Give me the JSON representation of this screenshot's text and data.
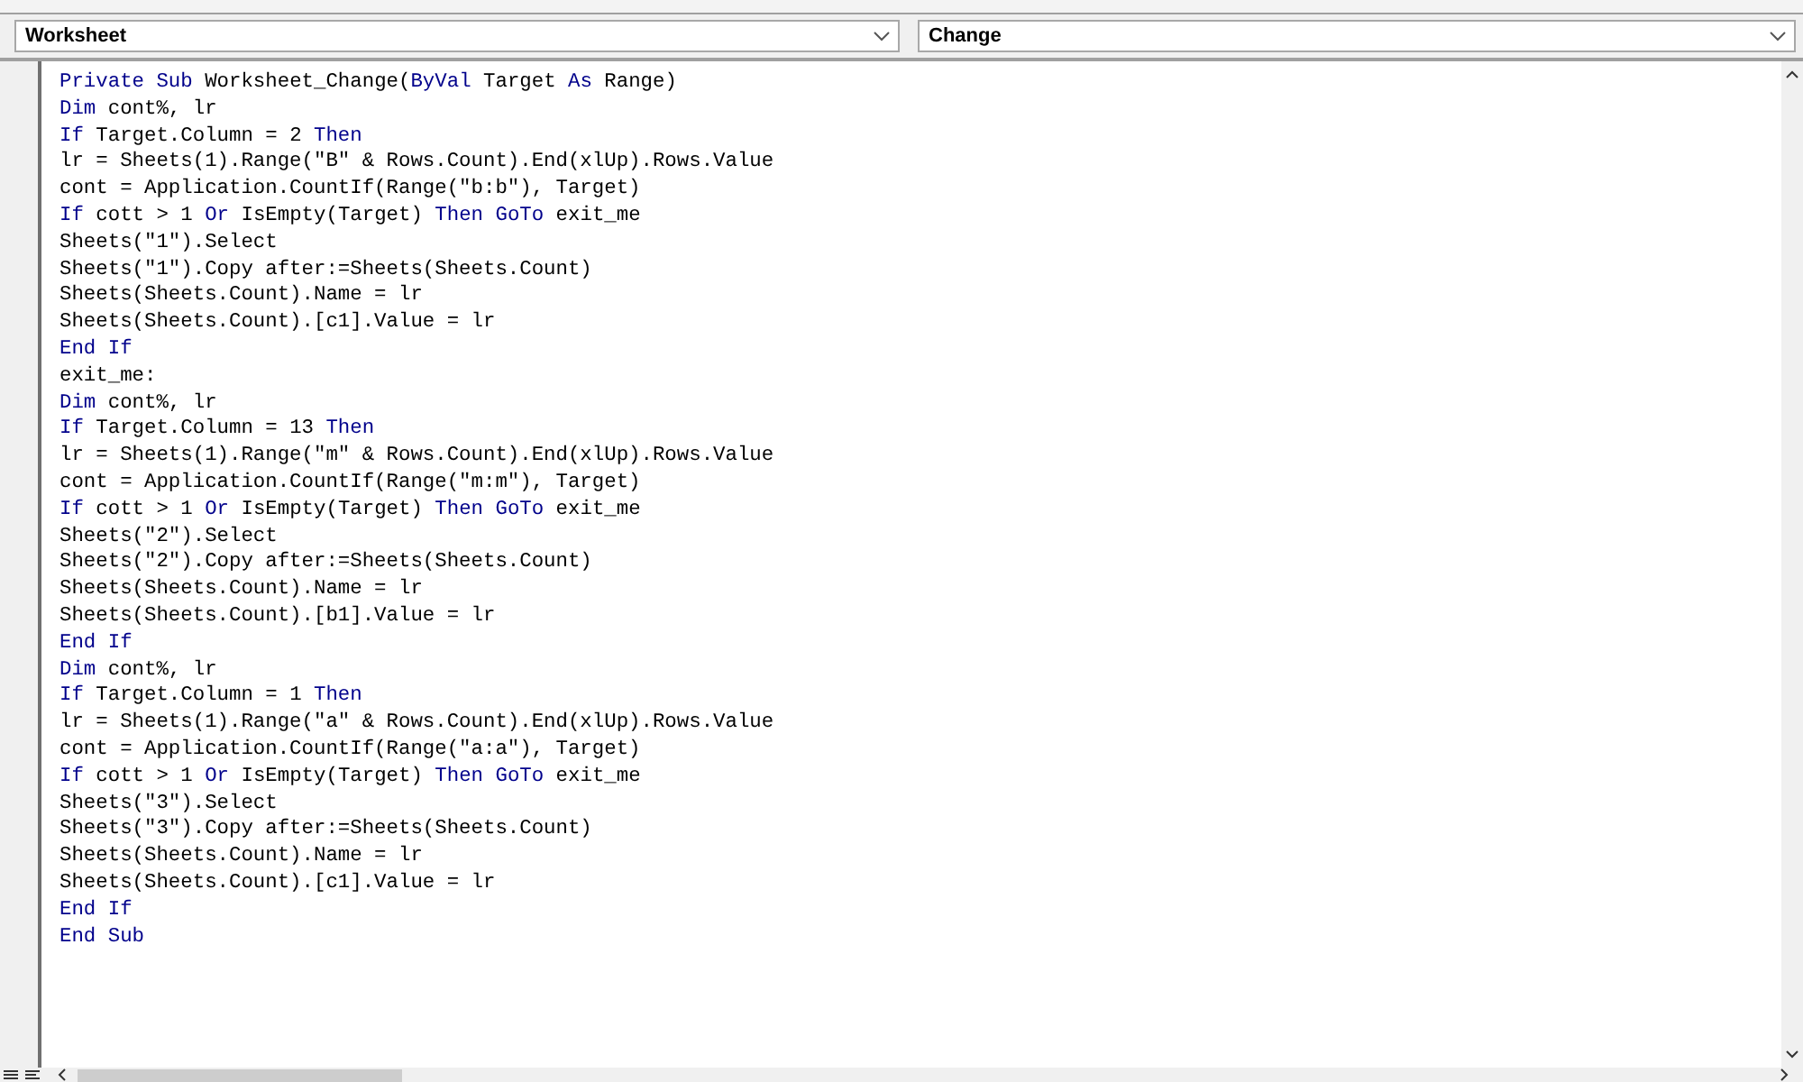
{
  "object_dropdown": {
    "value": "Worksheet"
  },
  "procedure_dropdown": {
    "value": "Change"
  },
  "code_lines": [
    {
      "tokens": [
        {
          "kind": "keyword",
          "text": "Private Sub"
        },
        {
          "kind": "plain",
          "text": " Worksheet_Change("
        },
        {
          "kind": "keyword",
          "text": "ByVal"
        },
        {
          "kind": "plain",
          "text": " Target "
        },
        {
          "kind": "keyword",
          "text": "As"
        },
        {
          "kind": "plain",
          "text": " Range)"
        }
      ]
    },
    {
      "tokens": [
        {
          "kind": "keyword",
          "text": "Dim"
        },
        {
          "kind": "plain",
          "text": " cont%, lr"
        }
      ]
    },
    {
      "tokens": [
        {
          "kind": "keyword",
          "text": "If"
        },
        {
          "kind": "plain",
          "text": " Target.Column = 2 "
        },
        {
          "kind": "keyword",
          "text": "Then"
        }
      ]
    },
    {
      "tokens": [
        {
          "kind": "plain",
          "text": "lr = Sheets(1).Range(\"B\" & Rows.Count).End(xlUp).Rows.Value"
        }
      ]
    },
    {
      "tokens": [
        {
          "kind": "plain",
          "text": "cont = Application.CountIf(Range(\"b:b\"), Target)"
        }
      ]
    },
    {
      "tokens": [
        {
          "kind": "keyword",
          "text": "If"
        },
        {
          "kind": "plain",
          "text": " cott > 1 "
        },
        {
          "kind": "keyword",
          "text": "Or"
        },
        {
          "kind": "plain",
          "text": " IsEmpty(Target) "
        },
        {
          "kind": "keyword",
          "text": "Then GoTo"
        },
        {
          "kind": "plain",
          "text": " exit_me"
        }
      ]
    },
    {
      "tokens": [
        {
          "kind": "plain",
          "text": "Sheets(\"1\").Select"
        }
      ]
    },
    {
      "tokens": [
        {
          "kind": "plain",
          "text": "Sheets(\"1\").Copy after:=Sheets(Sheets.Count)"
        }
      ]
    },
    {
      "tokens": [
        {
          "kind": "plain",
          "text": "Sheets(Sheets.Count).Name = lr"
        }
      ]
    },
    {
      "tokens": [
        {
          "kind": "plain",
          "text": "Sheets(Sheets.Count).[c1].Value = lr"
        }
      ]
    },
    {
      "tokens": [
        {
          "kind": "keyword",
          "text": "End If"
        }
      ]
    },
    {
      "tokens": [
        {
          "kind": "plain",
          "text": "exit_me:"
        }
      ]
    },
    {
      "tokens": [
        {
          "kind": "keyword",
          "text": "Dim"
        },
        {
          "kind": "plain",
          "text": " cont%, lr"
        }
      ]
    },
    {
      "tokens": [
        {
          "kind": "keyword",
          "text": "If"
        },
        {
          "kind": "plain",
          "text": " Target.Column = 13 "
        },
        {
          "kind": "keyword",
          "text": "Then"
        }
      ]
    },
    {
      "tokens": [
        {
          "kind": "plain",
          "text": "lr = Sheets(1).Range(\"m\" & Rows.Count).End(xlUp).Rows.Value"
        }
      ]
    },
    {
      "tokens": [
        {
          "kind": "plain",
          "text": "cont = Application.CountIf(Range(\"m:m\"), Target)"
        }
      ]
    },
    {
      "tokens": [
        {
          "kind": "keyword",
          "text": "If"
        },
        {
          "kind": "plain",
          "text": " cott > 1 "
        },
        {
          "kind": "keyword",
          "text": "Or"
        },
        {
          "kind": "plain",
          "text": " IsEmpty(Target) "
        },
        {
          "kind": "keyword",
          "text": "Then GoTo"
        },
        {
          "kind": "plain",
          "text": " exit_me"
        }
      ]
    },
    {
      "tokens": [
        {
          "kind": "plain",
          "text": "Sheets(\"2\").Select"
        }
      ]
    },
    {
      "tokens": [
        {
          "kind": "plain",
          "text": "Sheets(\"2\").Copy after:=Sheets(Sheets.Count)"
        }
      ]
    },
    {
      "tokens": [
        {
          "kind": "plain",
          "text": "Sheets(Sheets.Count).Name = lr"
        }
      ]
    },
    {
      "tokens": [
        {
          "kind": "plain",
          "text": "Sheets(Sheets.Count).[b1].Value = lr"
        }
      ]
    },
    {
      "tokens": [
        {
          "kind": "keyword",
          "text": "End If"
        }
      ]
    },
    {
      "tokens": [
        {
          "kind": "keyword",
          "text": "Dim"
        },
        {
          "kind": "plain",
          "text": " cont%, lr"
        }
      ]
    },
    {
      "tokens": [
        {
          "kind": "keyword",
          "text": "If"
        },
        {
          "kind": "plain",
          "text": " Target.Column = 1 "
        },
        {
          "kind": "keyword",
          "text": "Then"
        }
      ]
    },
    {
      "tokens": [
        {
          "kind": "plain",
          "text": "lr = Sheets(1).Range(\"a\" & Rows.Count).End(xlUp).Rows.Value"
        }
      ]
    },
    {
      "tokens": [
        {
          "kind": "plain",
          "text": "cont = Application.CountIf(Range(\"a:a\"), Target)"
        }
      ]
    },
    {
      "tokens": [
        {
          "kind": "keyword",
          "text": "If"
        },
        {
          "kind": "plain",
          "text": " cott > 1 "
        },
        {
          "kind": "keyword",
          "text": "Or"
        },
        {
          "kind": "plain",
          "text": " IsEmpty(Target) "
        },
        {
          "kind": "keyword",
          "text": "Then GoTo"
        },
        {
          "kind": "plain",
          "text": " exit_me"
        }
      ]
    },
    {
      "tokens": [
        {
          "kind": "plain",
          "text": "Sheets(\"3\").Select"
        }
      ]
    },
    {
      "tokens": [
        {
          "kind": "plain",
          "text": "Sheets(\"3\").Copy after:=Sheets(Sheets.Count)"
        }
      ]
    },
    {
      "tokens": [
        {
          "kind": "plain",
          "text": "Sheets(Sheets.Count).Name = lr"
        }
      ]
    },
    {
      "tokens": [
        {
          "kind": "plain",
          "text": "Sheets(Sheets.Count).[c1].Value = lr"
        }
      ]
    },
    {
      "tokens": [
        {
          "kind": "keyword",
          "text": "End If"
        }
      ]
    },
    {
      "tokens": [
        {
          "kind": "keyword",
          "text": "End Sub"
        }
      ]
    }
  ]
}
